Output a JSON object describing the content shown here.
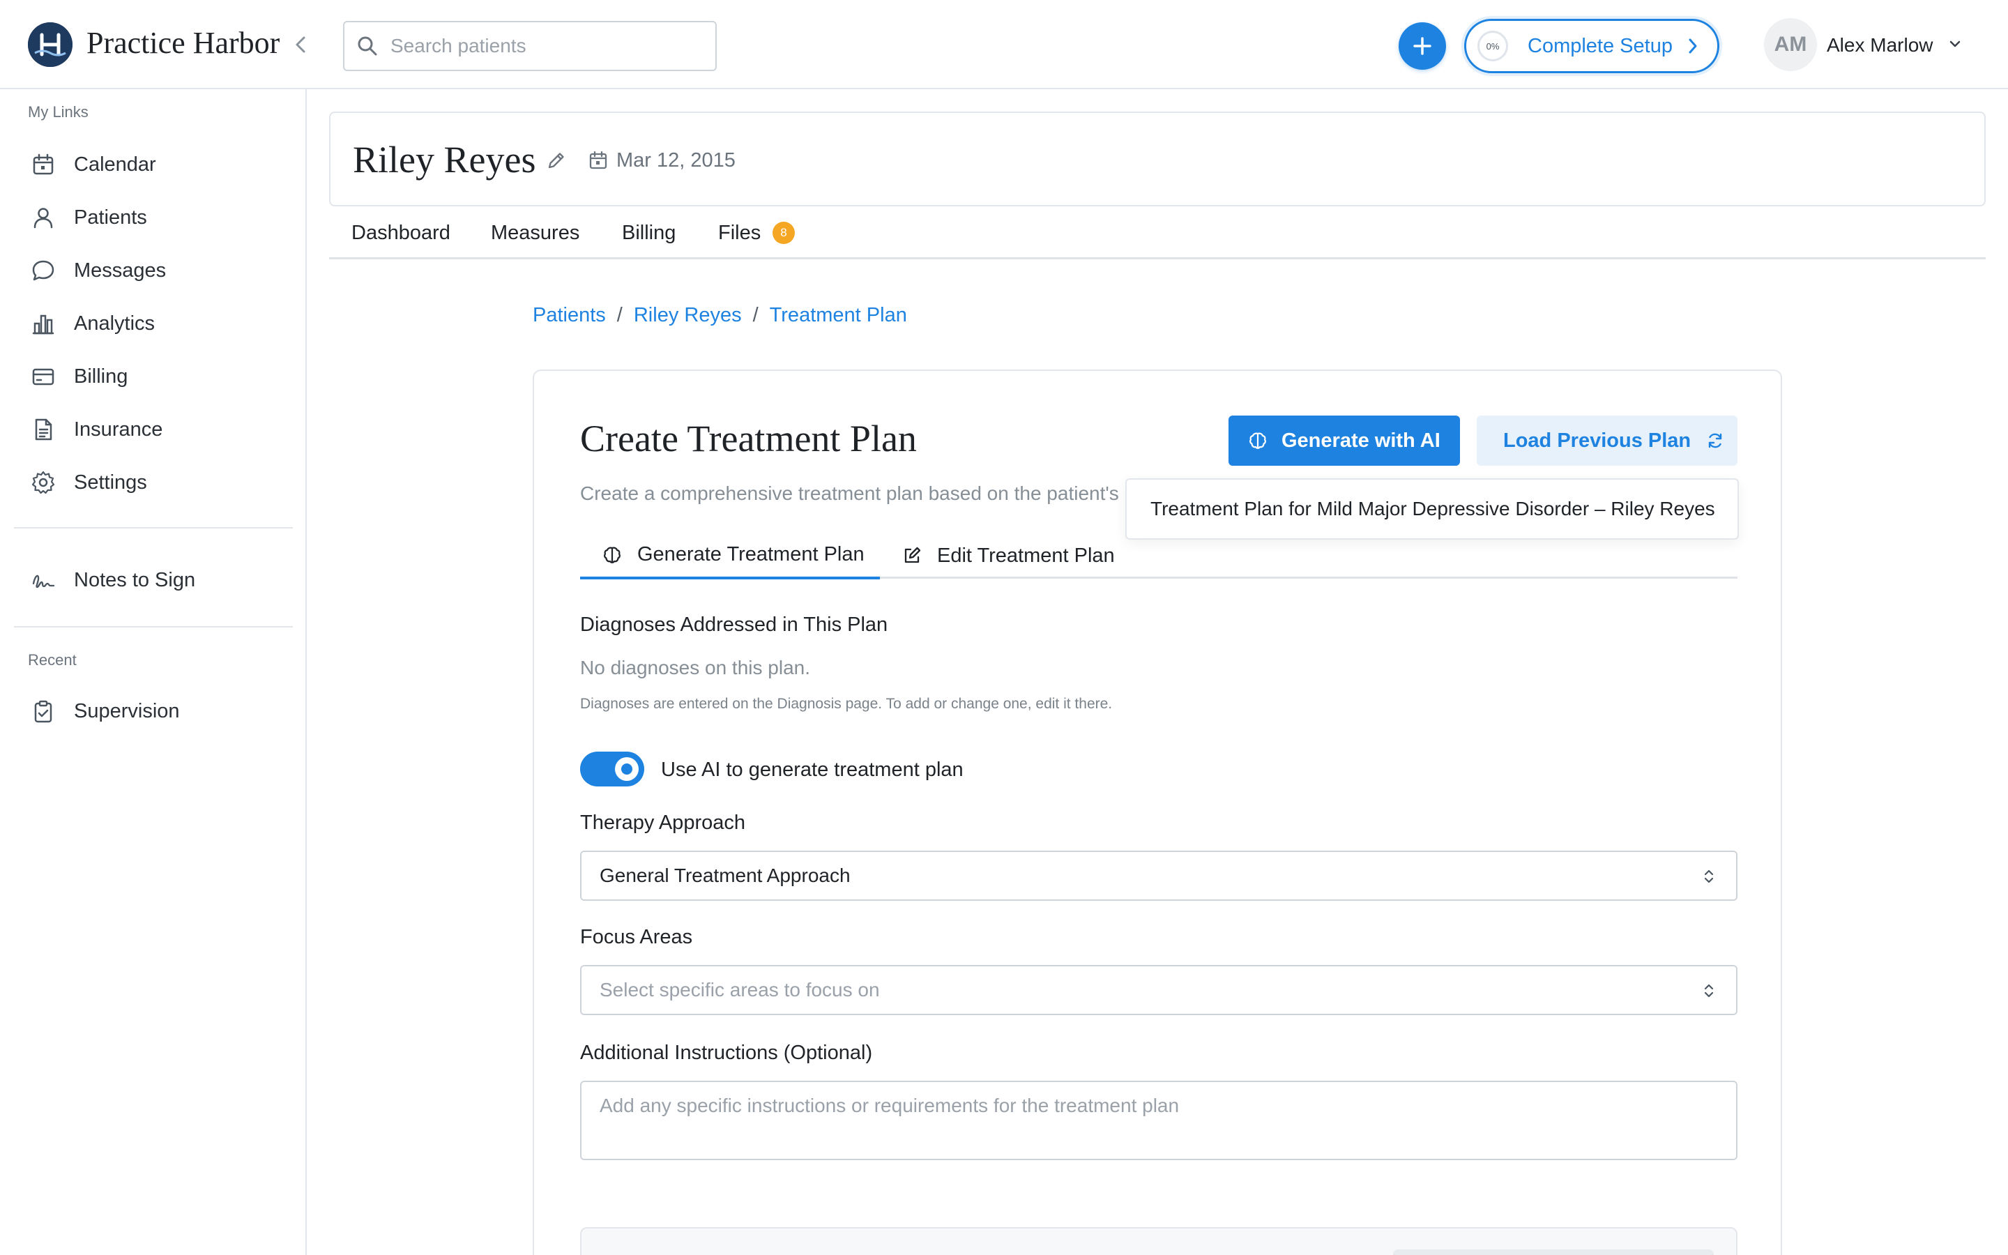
{
  "app": {
    "brand": "Practice Harbor",
    "accent_color": "#1d82e0"
  },
  "header": {
    "search_placeholder": "Search patients",
    "setup": {
      "progress_label": "0%",
      "label": "Complete Setup"
    },
    "user": {
      "initials": "AM",
      "name": "Alex Marlow"
    }
  },
  "sidebar": {
    "my_links_label": "My Links",
    "items": [
      {
        "label": "Calendar",
        "icon": "calendar-icon"
      },
      {
        "label": "Patients",
        "icon": "person-icon"
      },
      {
        "label": "Messages",
        "icon": "chat-bubble-icon"
      },
      {
        "label": "Analytics",
        "icon": "bar-chart-icon"
      },
      {
        "label": "Billing",
        "icon": "credit-card-icon"
      },
      {
        "label": "Insurance",
        "icon": "document-icon"
      },
      {
        "label": "Settings",
        "icon": "gear-icon"
      }
    ],
    "notes_to_sign": {
      "label": "Notes to Sign",
      "icon": "signature-icon"
    },
    "recent_label": "Recent",
    "recent_items": [
      {
        "label": "Supervision",
        "icon": "clipboard-check-icon"
      }
    ]
  },
  "patient": {
    "name": "Riley Reyes",
    "dob": "Mar 12, 2015"
  },
  "patient_tabs": [
    {
      "label": "Dashboard"
    },
    {
      "label": "Measures"
    },
    {
      "label": "Billing"
    },
    {
      "label": "Files",
      "badge": "8"
    }
  ],
  "breadcrumb": {
    "items": [
      "Patients",
      "Riley Reyes",
      "Treatment Plan"
    ],
    "separator": "/"
  },
  "plan": {
    "title": "Create Treatment Plan",
    "subtitle": "Create a comprehensive treatment plan based on the patient's",
    "generate_button": "Generate with AI",
    "load_button": "Load Previous Plan",
    "previous_plan_option": "Treatment Plan for Mild Major Depressive Disorder – Riley Reyes",
    "tabs": [
      {
        "label": "Generate Treatment Plan",
        "active": true
      },
      {
        "label": "Edit Treatment Plan",
        "active": false
      }
    ],
    "diagnoses": {
      "label": "Diagnoses Addressed in This Plan",
      "empty_text": "No diagnoses on this plan.",
      "hint": "Diagnoses are entered on the Diagnosis page. To add or change one, edit it there."
    },
    "use_ai": {
      "label": "Use AI to generate treatment plan",
      "enabled": true
    },
    "therapy_approach": {
      "label": "Therapy Approach",
      "value": "General Treatment Approach"
    },
    "focus_areas": {
      "label": "Focus Areas",
      "placeholder": "Select specific areas to focus on"
    },
    "additional_instructions": {
      "label": "Additional Instructions (Optional)",
      "placeholder": "Add any specific instructions or requirements for the treatment plan",
      "value": ""
    }
  }
}
